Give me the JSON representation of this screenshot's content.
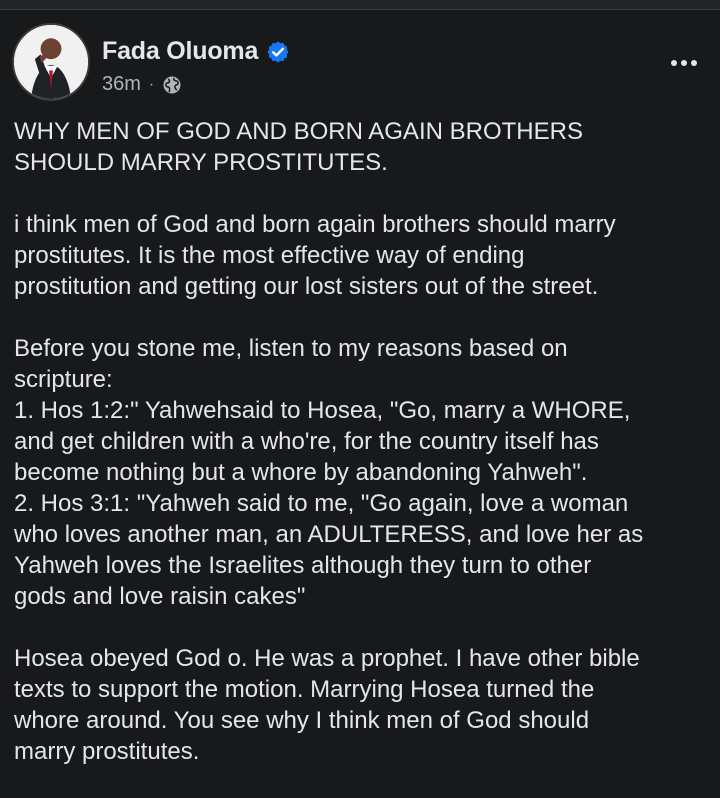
{
  "post": {
    "author": "Fada Oluoma",
    "time": "36m",
    "separator": "·",
    "icons": {
      "verified": "verified-badge-icon",
      "audience": "globe-icon",
      "menu": "more-options-icon"
    },
    "colors": {
      "background": "#18191a",
      "text": "#e4e6eb",
      "meta": "#b0b3b8",
      "verified": "#1877f2"
    },
    "paragraphs": [
      [
        "WHY MEN OF GOD AND BORN AGAIN BROTHERS",
        "SHOULD MARRY PROSTITUTES."
      ],
      [
        "i think men of God and born again brothers should marry",
        "prostitutes. It is the most effective way of ending",
        "prostitution and getting our lost sisters out of the street."
      ],
      [
        "Before you stone me, listen to my reasons based on",
        "scripture:",
        "1. Hos 1:2:\" Yahwehsaid to Hosea,  \"Go, marry a WHORE,",
        "and get children with a who're,  for the country itself has",
        "become nothing but a whore by abandoning Yahweh\".",
        "2. Hos 3:1: \"Yahweh said to me, \"Go again, love a woman",
        "who loves another man, an ADULTERESS,  and love her as",
        "Yahweh loves the Israelites although they turn to other",
        "gods and love raisin cakes\""
      ],
      [
        "Hosea obeyed God o. He was a prophet. I have other bible",
        "texts to support the motion. Marrying Hosea turned the",
        "whore around. You see why I think men of God should",
        "marry prostitutes."
      ]
    ]
  }
}
